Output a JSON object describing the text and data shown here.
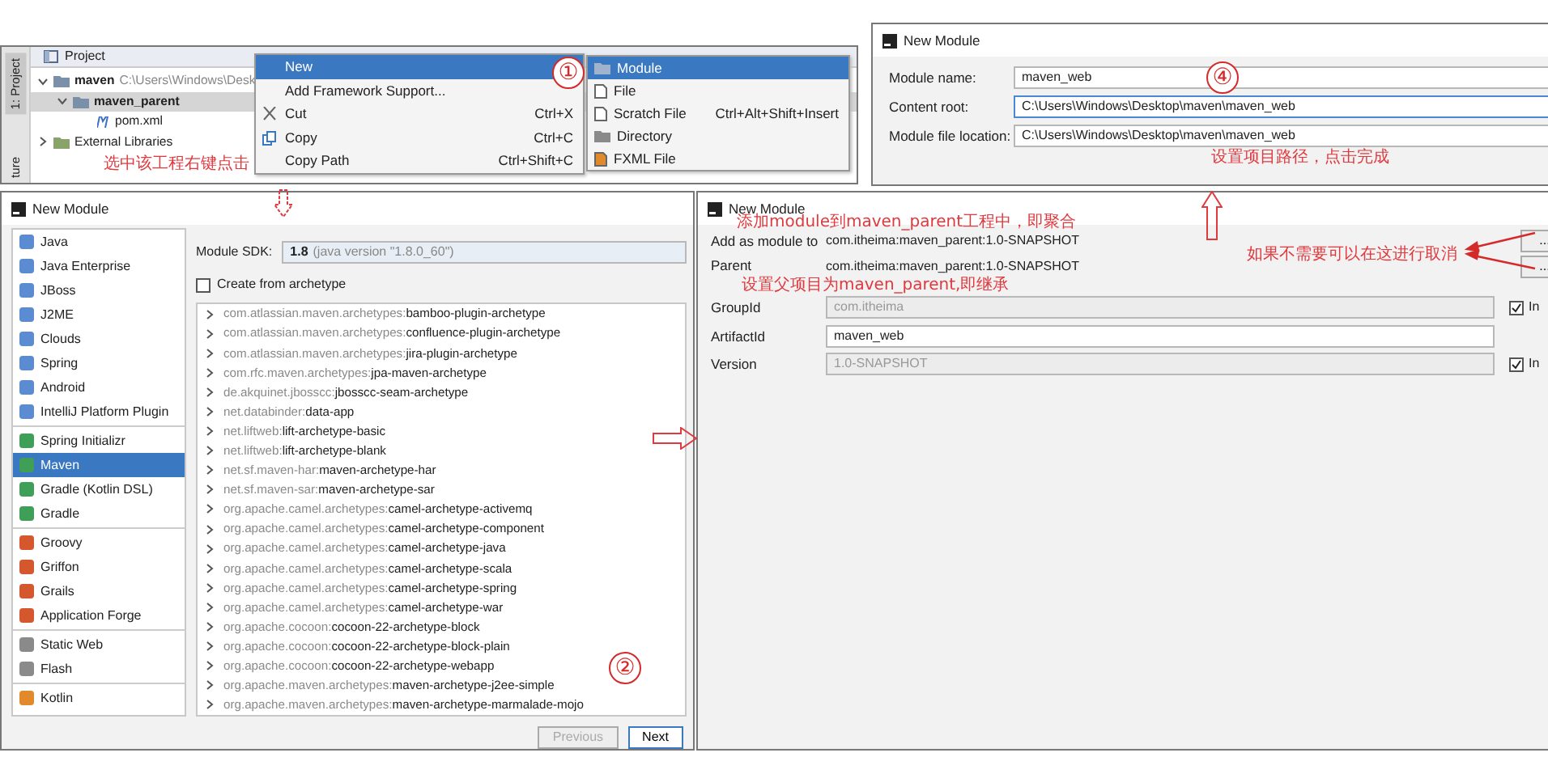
{
  "project_window": {
    "title": "Project",
    "side_tabs": [
      {
        "label": "1: Project",
        "selected": true
      },
      {
        "label": "ture",
        "selected": false
      }
    ],
    "tree": [
      {
        "label": "maven",
        "detail": "C:\\Users\\Windows\\Desk",
        "expanded": true,
        "selected": false,
        "children": [
          {
            "label": "maven_parent",
            "expanded": true,
            "selected": true,
            "children": [
              {
                "label": "pom.xml",
                "selected": false
              }
            ]
          }
        ]
      },
      {
        "label": "External Libraries",
        "expanded": false,
        "selected": false
      }
    ],
    "note": "选中该工程右键点击",
    "step": "①",
    "context_menu": [
      {
        "label": "New",
        "selected": true
      },
      {
        "label": "Add Framework Support...",
        "selected": false
      },
      {
        "label": "Cut",
        "shortcut": "Ctrl+X",
        "selected": false
      },
      {
        "label": "Copy",
        "shortcut": "Ctrl+C",
        "selected": false
      },
      {
        "label": "Copy Path",
        "shortcut": "Ctrl+Shift+C",
        "selected": false
      }
    ],
    "submenu": [
      {
        "label": "Module",
        "selected": true
      },
      {
        "label": "File",
        "selected": false
      },
      {
        "label": "Scratch File",
        "shortcut": "Ctrl+Alt+Shift+Insert",
        "selected": false
      },
      {
        "label": "Directory",
        "selected": false
      },
      {
        "label": "FXML File",
        "selected": false
      }
    ]
  },
  "location_dialog": {
    "title": "New Module",
    "step": "④",
    "note": "设置项目路径，点击完成",
    "fields": [
      {
        "label": "Module name:",
        "value": "maven_web",
        "focused": false
      },
      {
        "label": "Content root:",
        "value": "C:\\Users\\Windows\\Desktop\\maven\\maven_web",
        "focused": true
      },
      {
        "label": "Module file location:",
        "value": "C:\\Users\\Windows\\Desktop\\maven\\maven_web",
        "focused": false
      }
    ]
  },
  "archetype_dialog": {
    "title": "New Module",
    "sidebar": [
      [
        {
          "label": "Java",
          "selected": false
        },
        {
          "label": "Java Enterprise",
          "selected": false
        },
        {
          "label": "JBoss",
          "selected": false
        },
        {
          "label": "J2ME",
          "selected": false
        },
        {
          "label": "Clouds",
          "selected": false
        },
        {
          "label": "Spring",
          "selected": false
        },
        {
          "label": "Android",
          "selected": false
        },
        {
          "label": "IntelliJ Platform Plugin",
          "selected": false
        }
      ],
      [
        {
          "label": "Spring Initializr",
          "selected": false
        },
        {
          "label": "Maven",
          "selected": true
        },
        {
          "label": "Gradle (Kotlin DSL)",
          "selected": false
        },
        {
          "label": "Gradle",
          "selected": false
        }
      ],
      [
        {
          "label": "Groovy",
          "selected": false
        },
        {
          "label": "Griffon",
          "selected": false
        },
        {
          "label": "Grails",
          "selected": false
        },
        {
          "label": "Application Forge",
          "selected": false
        }
      ],
      [
        {
          "label": "Static Web",
          "selected": false
        },
        {
          "label": "Flash",
          "selected": false
        }
      ],
      [
        {
          "label": "Kotlin",
          "selected": false
        }
      ]
    ],
    "sdk_label": "Module SDK:",
    "sdk_value": "1.8",
    "sdk_detail": "(java version \"1.8.0_60\")",
    "archetype_checkbox": {
      "label": "Create from archetype",
      "checked": false
    },
    "archetypes": [
      {
        "group": "com.atlassian.maven.archetypes:",
        "artifact": "bamboo-plugin-archetype"
      },
      {
        "group": "com.atlassian.maven.archetypes:",
        "artifact": "confluence-plugin-archetype"
      },
      {
        "group": "com.atlassian.maven.archetypes:",
        "artifact": "jira-plugin-archetype"
      },
      {
        "group": "com.rfc.maven.archetypes:",
        "artifact": "jpa-maven-archetype"
      },
      {
        "group": "de.akquinet.jbosscc:",
        "artifact": "jbosscc-seam-archetype"
      },
      {
        "group": "net.databinder:",
        "artifact": "data-app"
      },
      {
        "group": "net.liftweb:",
        "artifact": "lift-archetype-basic"
      },
      {
        "group": "net.liftweb:",
        "artifact": "lift-archetype-blank"
      },
      {
        "group": "net.sf.maven-har:",
        "artifact": "maven-archetype-har"
      },
      {
        "group": "net.sf.maven-sar:",
        "artifact": "maven-archetype-sar"
      },
      {
        "group": "org.apache.camel.archetypes:",
        "artifact": "camel-archetype-activemq"
      },
      {
        "group": "org.apache.camel.archetypes:",
        "artifact": "camel-archetype-component"
      },
      {
        "group": "org.apache.camel.archetypes:",
        "artifact": "camel-archetype-java"
      },
      {
        "group": "org.apache.camel.archetypes:",
        "artifact": "camel-archetype-scala"
      },
      {
        "group": "org.apache.camel.archetypes:",
        "artifact": "camel-archetype-spring"
      },
      {
        "group": "org.apache.camel.archetypes:",
        "artifact": "camel-archetype-war"
      },
      {
        "group": "org.apache.cocoon:",
        "artifact": "cocoon-22-archetype-block"
      },
      {
        "group": "org.apache.cocoon:",
        "artifact": "cocoon-22-archetype-block-plain"
      },
      {
        "group": "org.apache.cocoon:",
        "artifact": "cocoon-22-archetype-webapp"
      },
      {
        "group": "org.apache.maven.archetypes:",
        "artifact": "maven-archetype-j2ee-simple"
      },
      {
        "group": "org.apache.maven.archetypes:",
        "artifact": "maven-archetype-marmalade-mojo"
      }
    ],
    "step": "②",
    "buttons": [
      {
        "label": "Previous",
        "disabled": true
      },
      {
        "label": "Next",
        "disabled": false
      }
    ]
  },
  "parent_dialog": {
    "title": "New Module",
    "rows": [
      {
        "kind": "info",
        "label": "Add as module to",
        "value": "com.itheima:maven_parent:1.0-SNAPSHOT",
        "button": "..."
      },
      {
        "kind": "info",
        "label": "Parent",
        "value": "com.itheima:maven_parent:1.0-SNAPSHOT",
        "button": "..."
      },
      {
        "kind": "field",
        "label": "GroupId",
        "value": "com.itheima",
        "disabled": true,
        "inherit": {
          "label": "In",
          "checked": true
        }
      },
      {
        "kind": "field",
        "label": "ArtifactId",
        "value": "maven_web",
        "disabled": false
      },
      {
        "kind": "field",
        "label": "Version",
        "value": "1.0-SNAPSHOT",
        "disabled": true,
        "inherit": {
          "label": "In",
          "checked": true
        }
      }
    ],
    "notes": [
      "添加module到maven_parent工程中，即聚合",
      "设置父项目为maven_parent,即继承",
      "如果不需要可以在这进行取消"
    ]
  }
}
